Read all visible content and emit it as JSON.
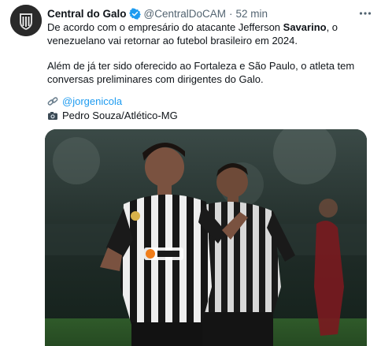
{
  "tweet": {
    "author_name": "Central do Galo",
    "handle": "@CentralDoCAM",
    "separator": "·",
    "time": "52 min",
    "paragraph1_a": "De acordo com o empresário do atacante Jefferson ",
    "paragraph1_bold": "Savarino",
    "paragraph1_b": ", o venezuelano vai retornar ao futebol brasileiro em 2024.",
    "paragraph2": "Além de já ter sido oferecido ao Fortaleza e São Paulo, o atleta tem conversas preliminares com dirigentes do Galo.",
    "source_link": "@jorgenicola",
    "photo_credit": "Pedro Souza/Atlético-MG"
  },
  "icons": {
    "verified": "verified-badge-icon",
    "more": "more-options-icon",
    "link": "link-icon",
    "camera": "camera-icon"
  },
  "colors": {
    "link": "#1d9bf0",
    "muted": "#536471",
    "text": "#0f1419"
  }
}
